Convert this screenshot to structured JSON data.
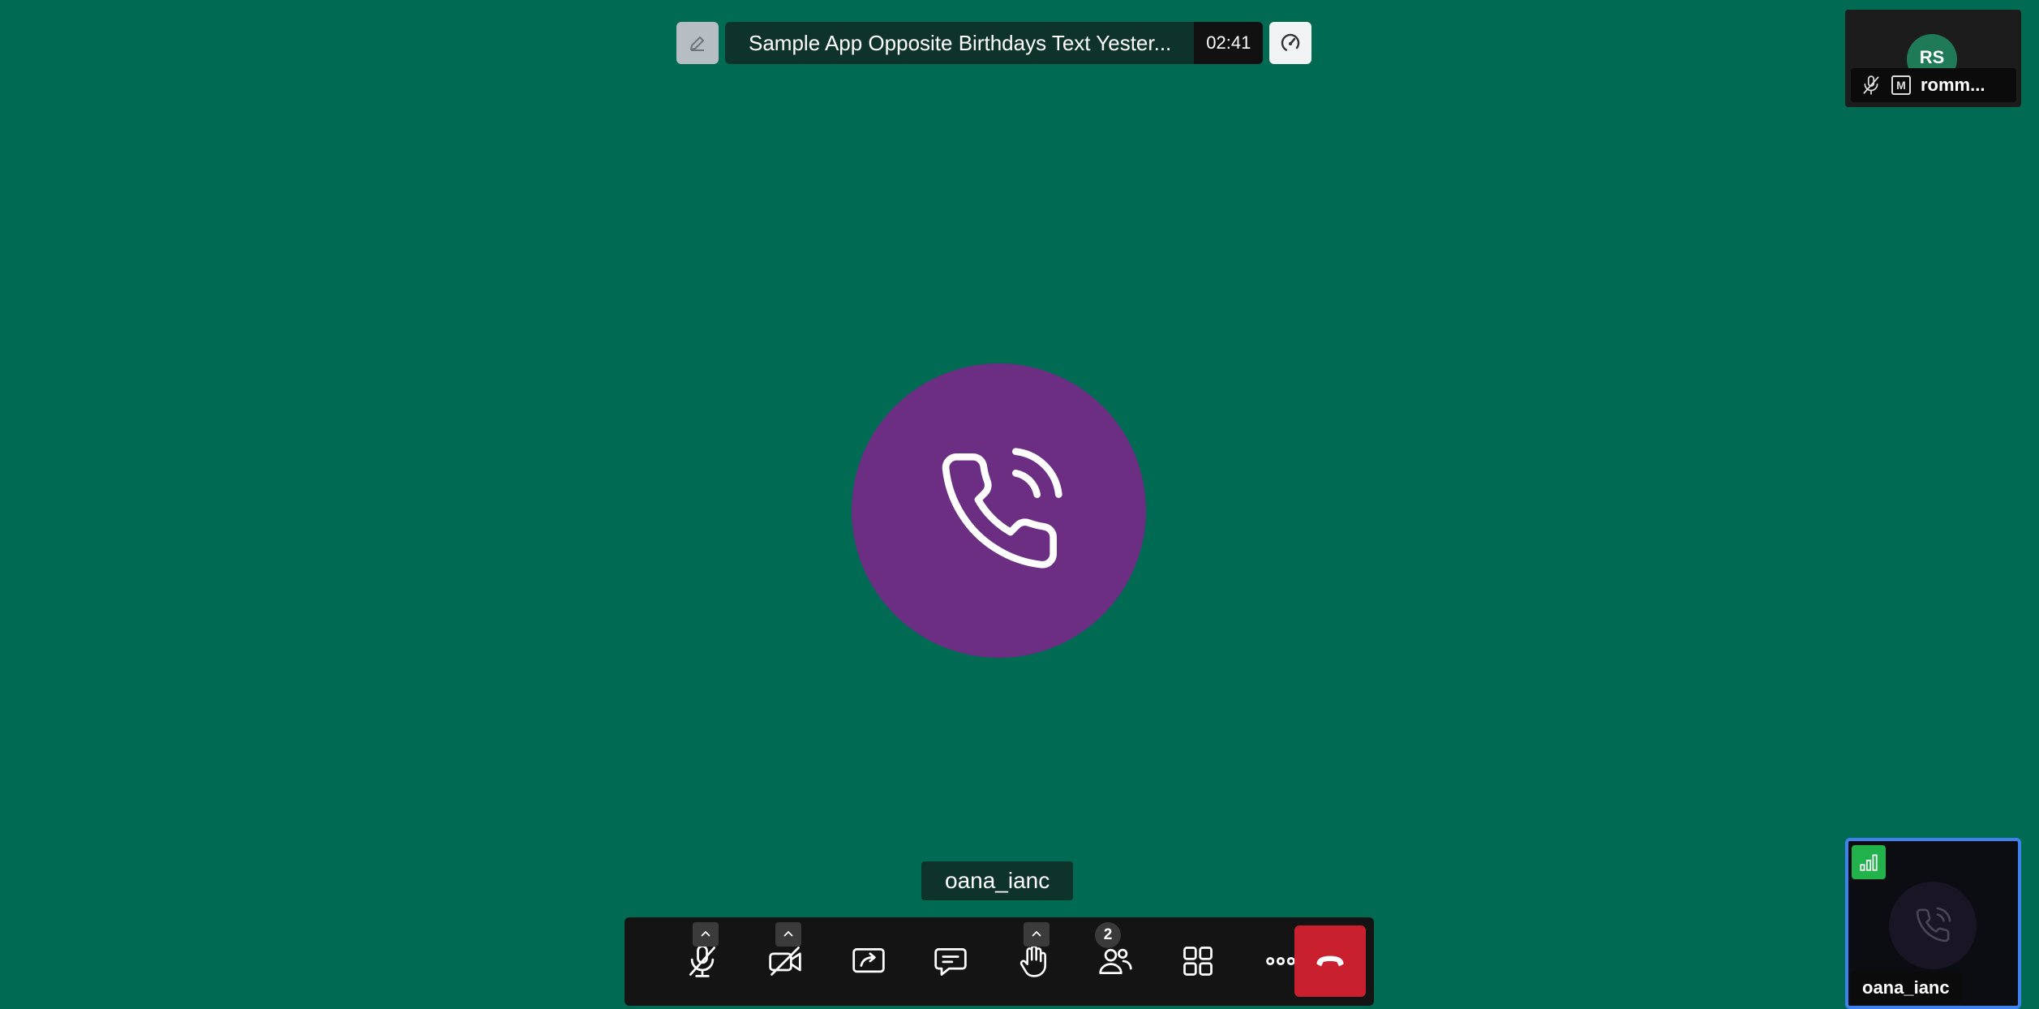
{
  "header": {
    "meeting_title": "Sample App Opposite Birthdays Text Yester...",
    "timer": "02:41"
  },
  "main": {
    "participant_name": "oana_ianc",
    "avatar_bg": "#6b2e83"
  },
  "toolbar": {
    "participants_count": "2",
    "hangup_color": "#c8202f"
  },
  "remote_tile": {
    "initials": "RS",
    "name": "romm...",
    "moderator_badge": "M"
  },
  "local_tile": {
    "name": "oana_ianc",
    "border_color": "#3f82ee"
  },
  "colors": {
    "background": "#006a52",
    "title_bg": "#0e332b",
    "toolbar_bg": "#141414"
  }
}
